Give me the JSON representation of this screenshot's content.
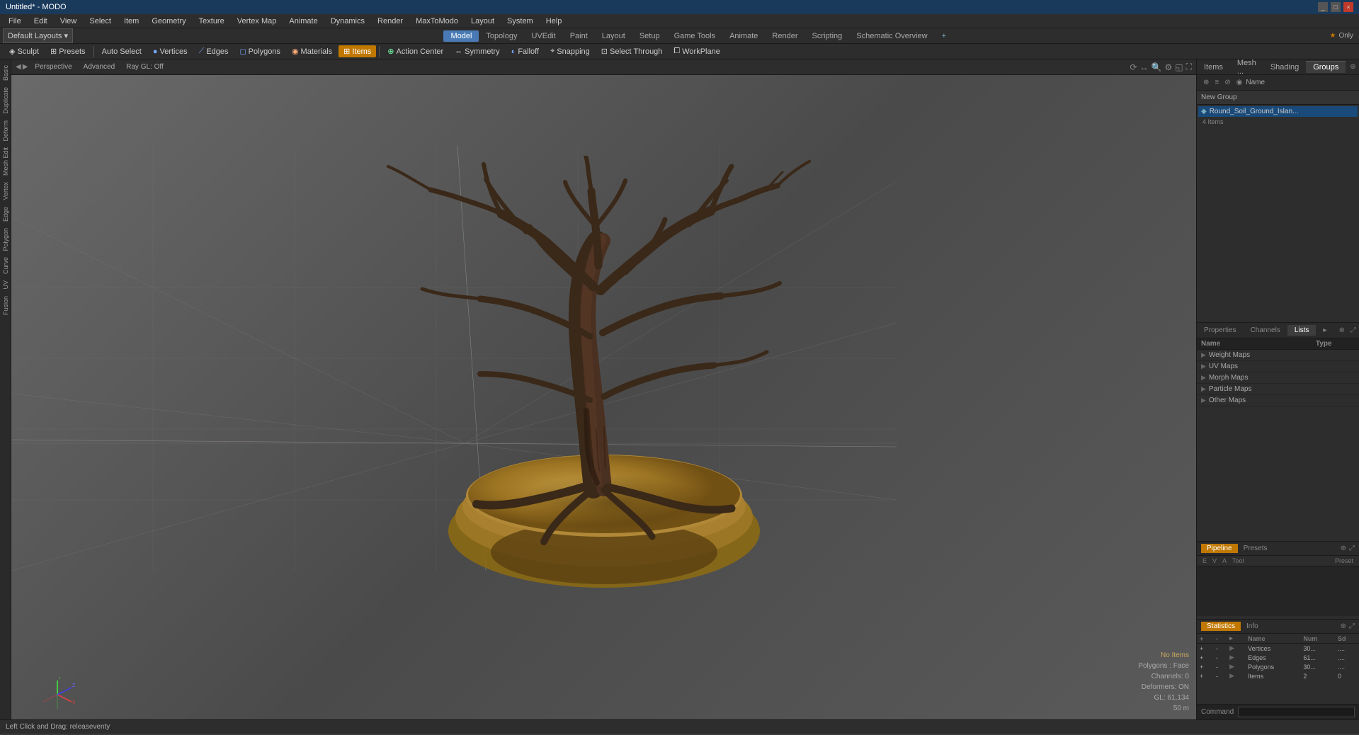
{
  "titleBar": {
    "title": "Untitled* - MODO",
    "controls": [
      "_",
      "□",
      "×"
    ]
  },
  "menuBar": {
    "items": [
      "File",
      "Edit",
      "View",
      "Select",
      "Item",
      "Geometry",
      "Texture",
      "Vertex Map",
      "Animate",
      "Dynamics",
      "Render",
      "MaxToModo",
      "Layout",
      "System",
      "Help"
    ]
  },
  "toolbar1": {
    "layoutLabel": "Default Layouts",
    "dropdownIcon": "▾"
  },
  "modeTabs": {
    "tabs": [
      {
        "label": "Model",
        "active": true
      },
      {
        "label": "Topology",
        "active": false
      },
      {
        "label": "UVEdit",
        "active": false
      },
      {
        "label": "Paint",
        "active": false
      },
      {
        "label": "Layout",
        "active": false
      },
      {
        "label": "Setup",
        "active": false
      },
      {
        "label": "Game Tools",
        "active": false
      },
      {
        "label": "Animate",
        "active": false
      },
      {
        "label": "Render",
        "active": false
      },
      {
        "label": "Scripting",
        "active": false
      },
      {
        "label": "Schematic Overview",
        "active": false
      }
    ],
    "addBtn": "+",
    "onlyLabel": "Only"
  },
  "toolbar2": {
    "sculpt": "Sculpt",
    "presets": "Presets",
    "autoSelect": "Auto Select",
    "vertices": "Vertices",
    "edges": "Edges",
    "polygons": "Polygons",
    "materials": "Materials",
    "items": "Items",
    "actionCenter": "Action Center",
    "symmetry": "Symmetry",
    "falloff": "Falloff",
    "snapping": "Snapping",
    "selectThrough": "Select Through",
    "workPlane": "WorkPlane"
  },
  "viewport": {
    "perspective": "Perspective",
    "advanced": "Advanced",
    "rayGL": "Ray GL: Off",
    "navIcons": [
      "⟳",
      "↔",
      "🔍",
      "⚙",
      "◱",
      "⛶"
    ]
  },
  "rightPanel": {
    "tabs": [
      "Items",
      "Mesh ...",
      "Shading",
      "Groups"
    ],
    "activeTab": "Groups",
    "expandIcon": "⊕",
    "resizeIcon": "⤢"
  },
  "itemsPanel": {
    "newGroupLabel": "New Group",
    "headerBtns": [
      "⊕",
      "≡",
      "⊘",
      "◉"
    ],
    "nameColumnLabel": "Name",
    "selectedItem": {
      "icon": "◆",
      "name": "Round_Soil_Ground_Islan...",
      "count": "4 Items"
    }
  },
  "propsTabs": {
    "tabs": [
      "Properties",
      "Channels",
      "Lists",
      "▸"
    ],
    "activeTab": "Lists",
    "resizeIcon": "⤢"
  },
  "listTable": {
    "headers": [
      "Name",
      "Type"
    ],
    "rows": [
      {
        "name": "Weight Maps",
        "type": ""
      },
      {
        "name": "UV Maps",
        "type": ""
      },
      {
        "name": "Morph Maps",
        "type": ""
      },
      {
        "name": "Particle Maps",
        "type": ""
      },
      {
        "name": "Other Maps",
        "type": ""
      }
    ]
  },
  "pipeline": {
    "tabs": [
      "Pipeline",
      "Presets"
    ],
    "activeTab": "Pipeline",
    "colHeaders": [
      "E",
      "V",
      "A",
      "Tool",
      "Preset"
    ]
  },
  "statistics": {
    "tabs": [
      "Statistics",
      "Info"
    ],
    "activeTab": "Statistics",
    "headers": [
      "+",
      "-",
      "▸",
      "Name",
      "Num",
      "Sd"
    ],
    "rows": [
      {
        "name": "Vertices",
        "num": "30...",
        "sd": "...."
      },
      {
        "name": "Edges",
        "num": "61...",
        "sd": "...."
      },
      {
        "name": "Polygons",
        "num": "30...",
        "sd": "...."
      },
      {
        "name": "Items",
        "num": "2",
        "sd": "0"
      }
    ]
  },
  "viewportStatus": {
    "noItems": "No Items",
    "polygonsLabel": "Polygons : Face",
    "channelsLabel": "Channels: 0",
    "deformersLabel": "Deformers: ON",
    "glLabel": "GL: 61,134",
    "unitLabel": "50 m"
  },
  "statusBar": {
    "text": "Left Click and Drag:  releaseventy"
  },
  "command": {
    "label": "Command"
  }
}
